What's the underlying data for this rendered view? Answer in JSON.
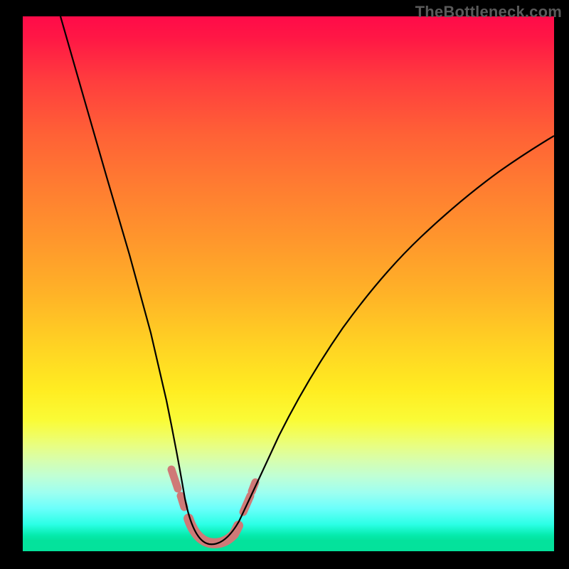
{
  "watermark": "TheBottleneck.com",
  "chart_data": {
    "type": "line",
    "title": "",
    "xlabel": "",
    "ylabel": "",
    "xlim": [
      0,
      100
    ],
    "ylim": [
      0,
      100
    ],
    "grid": false,
    "legend": false,
    "series": [
      {
        "name": "bottleneck-curve",
        "x": [
          0,
          5,
          10,
          15,
          20,
          25,
          28,
          30,
          32,
          34,
          36,
          38,
          40,
          45,
          50,
          55,
          60,
          65,
          70,
          75,
          80,
          85,
          90,
          95,
          100
        ],
        "y": [
          100,
          86,
          72,
          58,
          44,
          27,
          15,
          8,
          3,
          1,
          1,
          1,
          3,
          10,
          20,
          30,
          38,
          45,
          51,
          56,
          60,
          64,
          67,
          70,
          73
        ]
      }
    ],
    "highlights": [
      {
        "name": "left-entry-segment",
        "x_range": [
          27.5,
          29.5
        ]
      },
      {
        "name": "valley-segment",
        "x_range": [
          30.5,
          38.5
        ]
      },
      {
        "name": "right-exit-segment",
        "x_range": [
          40.0,
          41.5
        ]
      }
    ],
    "gradient_stops": [
      {
        "pos": 0,
        "color": "#ff0b49"
      },
      {
        "pos": 0.22,
        "color": "#ff6136"
      },
      {
        "pos": 0.52,
        "color": "#ffb327"
      },
      {
        "pos": 0.7,
        "color": "#ffed22"
      },
      {
        "pos": 0.83,
        "color": "#d7feae"
      },
      {
        "pos": 0.95,
        "color": "#2bffe5"
      },
      {
        "pos": 1.0,
        "color": "#04e29b"
      }
    ]
  }
}
